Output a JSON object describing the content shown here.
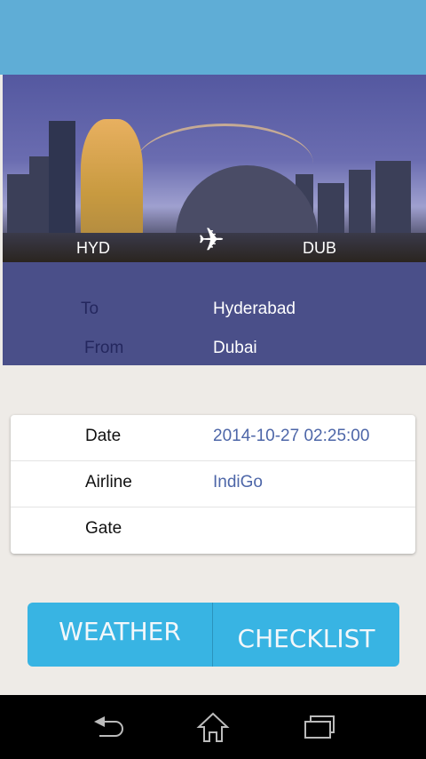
{
  "route": {
    "origin_code": "HYD",
    "destination_code": "DUB",
    "plane_icon": "airplane-icon"
  },
  "summary": {
    "to_label": "To",
    "to_value": "Hyderabad",
    "from_label": "From",
    "from_value": "Dubai"
  },
  "details": [
    {
      "label": "Date",
      "value": "2014-10-27 02:25:00"
    },
    {
      "label": "Airline",
      "value": "IndiGo"
    },
    {
      "label": "Gate",
      "value": ""
    }
  ],
  "buttons": {
    "weather": "WEATHER",
    "checklist": "CHECKLIST"
  },
  "colors": {
    "header": "#5fadd6",
    "panel": "#4a4f89",
    "button": "#38b4e3",
    "value": "#4d66a8"
  }
}
